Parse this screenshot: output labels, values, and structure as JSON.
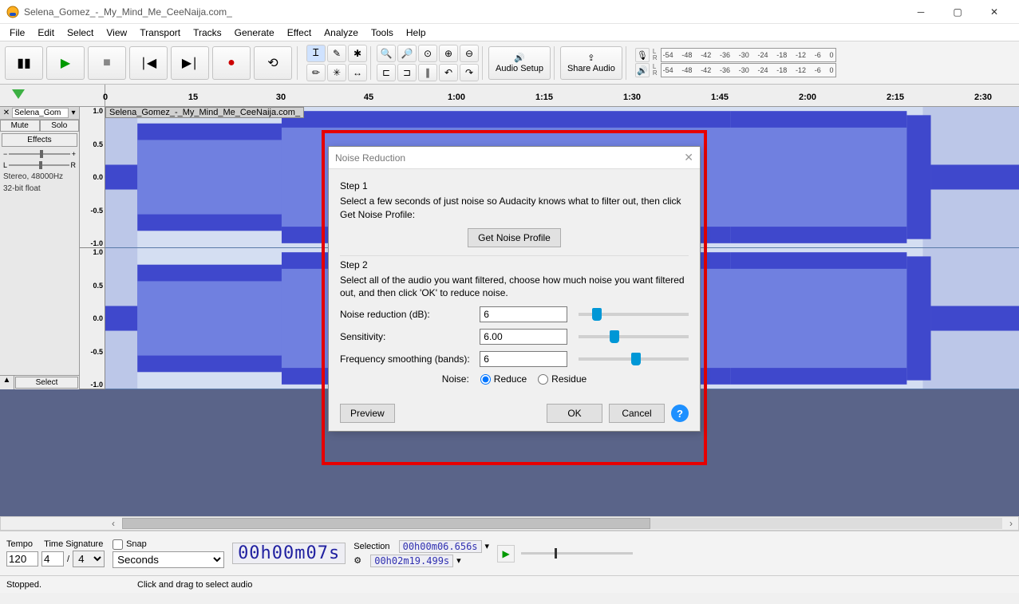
{
  "window": {
    "title": "Selena_Gomez_-_My_Mind_Me_CeeNaija.com_"
  },
  "menu": [
    "File",
    "Edit",
    "Select",
    "View",
    "Transport",
    "Tracks",
    "Generate",
    "Effect",
    "Analyze",
    "Tools",
    "Help"
  ],
  "toolbar": {
    "audio_setup": "Audio Setup",
    "share_audio": "Share Audio"
  },
  "meter": {
    "ticks": [
      "-54",
      "-48",
      "-42",
      "-36",
      "-30",
      "-24",
      "-18",
      "-12",
      "-6",
      "0"
    ]
  },
  "ruler": {
    "ticks": [
      {
        "label": "0",
        "pos": 0
      },
      {
        "label": "15",
        "pos": 110
      },
      {
        "label": "30",
        "pos": 220
      },
      {
        "label": "45",
        "pos": 330
      },
      {
        "label": "1:00",
        "pos": 440
      },
      {
        "label": "1:15",
        "pos": 550
      },
      {
        "label": "1:30",
        "pos": 660
      },
      {
        "label": "1:45",
        "pos": 770
      },
      {
        "label": "2:00",
        "pos": 880
      },
      {
        "label": "2:15",
        "pos": 990
      },
      {
        "label": "2:30",
        "pos": 1100
      }
    ]
  },
  "track": {
    "name_short": "Selena_Gom",
    "name_full": "Selena_Gomez_-_My_Mind_Me_CeeNaija.com_",
    "mute": "Mute",
    "solo": "Solo",
    "effects": "Effects",
    "info1": "Stereo, 48000Hz",
    "info2": "32-bit float",
    "select": "Select",
    "amp": [
      "1.0",
      "0.5",
      "0.0",
      "-0.5",
      "-1.0"
    ]
  },
  "dialog": {
    "title": "Noise Reduction",
    "step1": "Step 1",
    "step1_desc": "Select a few seconds of just noise so Audacity knows what to filter out, then click Get Noise Profile:",
    "get_profile": "Get Noise Profile",
    "step2": "Step 2",
    "step2_desc": "Select all of the audio you want filtered, choose how much noise you want filtered out, and then click 'OK' to reduce noise.",
    "noise_reduction_label": "Noise reduction (dB):",
    "noise_reduction_value": "6",
    "sensitivity_label": "Sensitivity:",
    "sensitivity_value": "6.00",
    "freq_label": "Frequency smoothing (bands):",
    "freq_value": "6",
    "noise_label": "Noise:",
    "reduce": "Reduce",
    "residue": "Residue",
    "preview": "Preview",
    "ok": "OK",
    "cancel": "Cancel"
  },
  "bottom": {
    "tempo_label": "Tempo",
    "tempo_value": "120",
    "timesig_label": "Time Signature",
    "timesig_num": "4",
    "timesig_den": "4",
    "snap_label": "Snap",
    "snap_value": "Seconds",
    "time_display": "00h00m07s",
    "selection_label": "Selection",
    "sel_start": "00h00m06.656s",
    "sel_end": "00h02m19.499s"
  },
  "status": {
    "state": "Stopped.",
    "hint": "Click and drag to select audio"
  }
}
